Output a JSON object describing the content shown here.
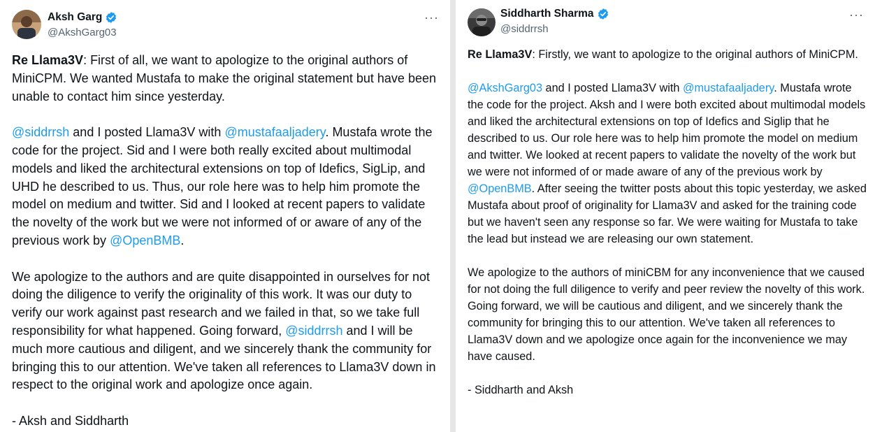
{
  "left": {
    "name": "Aksh Garg",
    "handle": "@AkshGarg03",
    "more_label": "···",
    "p1_lead": "Re Llama3V",
    "p1_text": ": First of all, we want to apologize to the original authors of MiniCPM. We wanted Mustafa to make the original statement but have been unable to contact him since yesterday.",
    "p2_mention1": "@siddrrsh",
    "p2_text1": " and I posted Llama3V with ",
    "p2_mention2": "@mustafaaljadery",
    "p2_text2": ". Mustafa wrote the code for the project. Sid and I were both really excited about multimodal models and liked the architectural extensions on top of Idefics, SigLip, and UHD he described to us. Thus, our role here was to help him promote the model on medium and twitter. Sid and I looked at recent papers to validate the novelty of the work but we were not informed of or aware of any of the previous work by ",
    "p2_mention3": "@OpenBMB",
    "p2_text3": ".",
    "p3_text1": "We apologize to the authors and are quite disappointed in ourselves for not doing the diligence to verify the originality of this work. It was our duty to verify our work against past research and we failed in that, so we take full responsibility for what happened. Going forward, ",
    "p3_mention1": "@siddrrsh",
    "p3_text2": " and I will be much more cautious and diligent, and we sincerely thank the community for bringing this to our attention. We've taken all references to Llama3V down in respect to the original work and apologize once again.",
    "p4_text": "- Aksh and Siddharth"
  },
  "right": {
    "name": "Siddharth Sharma",
    "handle": "@siddrrsh",
    "more_label": "···",
    "p1_lead": "Re Llama3V",
    "p1_text": ": Firstly, we want to apologize to the original authors of MiniCPM.",
    "p2_mention1": "@AkshGarg03",
    "p2_text1": " and I posted Llama3V with ",
    "p2_mention2": "@mustafaaljadery",
    "p2_text2": ". Mustafa wrote the code for the project. Aksh and I were both excited about multimodal models and liked the architectural extensions on top of Idefics and Siglip that he described to us. Our role here was to help him promote the model on medium and twitter. We looked at recent papers to validate the novelty of the work but we were not informed of or made aware of any of the previous work by ",
    "p2_mention3": "@OpenBMB",
    "p2_text3": ". After seeing the twitter posts about this topic yesterday, we asked Mustafa about proof of originality for Llama3V and asked for the training code but we haven't seen any response so far. We were waiting for Mustafa to take the lead but instead we are releasing our own statement.",
    "p3_text": "We apologize to the authors of miniCBM for any inconvenience that we caused for not doing the full diligence to verify and peer review the novelty of this work. Going forward, we will be cautious and diligent, and we sincerely thank the community for bringing this to our attention. We've taken all references to Llama3V down and we apologize once again for the inconvenience we may have caused.",
    "p4_text": "- Siddharth and Aksh"
  },
  "colors": {
    "mention": "#1d9bf0",
    "verified": "#1d9bf0",
    "text": "#0f1419",
    "secondary": "#536471",
    "divider": "#e6e6e6"
  },
  "icons": [
    "avatar-icon",
    "verified-badge-icon",
    "more-options-icon"
  ]
}
